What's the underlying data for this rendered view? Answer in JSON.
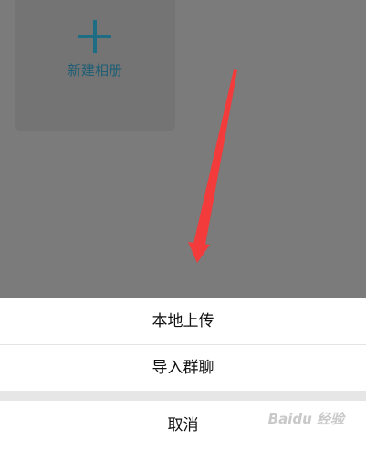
{
  "background_page": {
    "new_album_label": "新建相册"
  },
  "action_sheet": {
    "local_upload_label": "本地上传",
    "import_group_chat_label": "导入群聊",
    "cancel_label": "取消"
  },
  "annotation": {
    "arrow_color": "#f43b3b"
  },
  "watermark": {
    "text": "Baidu 经验"
  }
}
